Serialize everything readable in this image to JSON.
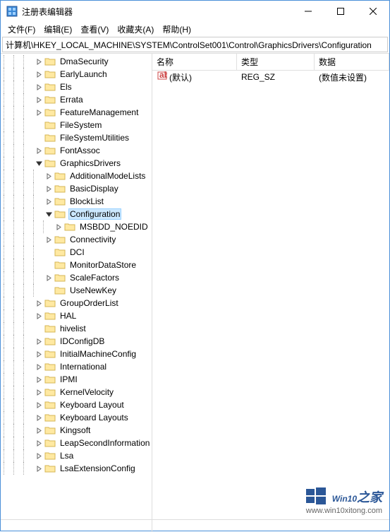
{
  "window": {
    "title": "注册表编辑器"
  },
  "menu": {
    "file": "文件(F)",
    "edit": "编辑(E)",
    "view": "查看(V)",
    "favorites": "收藏夹(A)",
    "help": "帮助(H)"
  },
  "address": "计算机\\HKEY_LOCAL_MACHINE\\SYSTEM\\ControlSet001\\Control\\GraphicsDrivers\\Configuration",
  "tree_items": [
    {
      "indent": 3,
      "toggle": ">",
      "label": "DmaSecurity",
      "selected": false
    },
    {
      "indent": 3,
      "toggle": ">",
      "label": "EarlyLaunch",
      "selected": false
    },
    {
      "indent": 3,
      "toggle": ">",
      "label": "Els",
      "selected": false
    },
    {
      "indent": 3,
      "toggle": ">",
      "label": "Errata",
      "selected": false
    },
    {
      "indent": 3,
      "toggle": ">",
      "label": "FeatureManagement",
      "selected": false
    },
    {
      "indent": 3,
      "toggle": "",
      "label": "FileSystem",
      "selected": false
    },
    {
      "indent": 3,
      "toggle": "",
      "label": "FileSystemUtilities",
      "selected": false
    },
    {
      "indent": 3,
      "toggle": ">",
      "label": "FontAssoc",
      "selected": false
    },
    {
      "indent": 3,
      "toggle": "v",
      "label": "GraphicsDrivers",
      "selected": false
    },
    {
      "indent": 4,
      "toggle": ">",
      "label": "AdditionalModeLists",
      "selected": false
    },
    {
      "indent": 4,
      "toggle": ">",
      "label": "BasicDisplay",
      "selected": false
    },
    {
      "indent": 4,
      "toggle": ">",
      "label": "BlockList",
      "selected": false
    },
    {
      "indent": 4,
      "toggle": "v",
      "label": "Configuration",
      "selected": true
    },
    {
      "indent": 5,
      "toggle": ">",
      "label": "MSBDD_NOEDID",
      "selected": false
    },
    {
      "indent": 4,
      "toggle": ">",
      "label": "Connectivity",
      "selected": false
    },
    {
      "indent": 4,
      "toggle": "",
      "label": "DCI",
      "selected": false
    },
    {
      "indent": 4,
      "toggle": "",
      "label": "MonitorDataStore",
      "selected": false
    },
    {
      "indent": 4,
      "toggle": ">",
      "label": "ScaleFactors",
      "selected": false
    },
    {
      "indent": 4,
      "toggle": "",
      "label": "UseNewKey",
      "selected": false
    },
    {
      "indent": 3,
      "toggle": ">",
      "label": "GroupOrderList",
      "selected": false
    },
    {
      "indent": 3,
      "toggle": ">",
      "label": "HAL",
      "selected": false
    },
    {
      "indent": 3,
      "toggle": "",
      "label": "hivelist",
      "selected": false
    },
    {
      "indent": 3,
      "toggle": ">",
      "label": "IDConfigDB",
      "selected": false
    },
    {
      "indent": 3,
      "toggle": ">",
      "label": "InitialMachineConfig",
      "selected": false
    },
    {
      "indent": 3,
      "toggle": ">",
      "label": "International",
      "selected": false
    },
    {
      "indent": 3,
      "toggle": ">",
      "label": "IPMI",
      "selected": false
    },
    {
      "indent": 3,
      "toggle": ">",
      "label": "KernelVelocity",
      "selected": false
    },
    {
      "indent": 3,
      "toggle": ">",
      "label": "Keyboard Layout",
      "selected": false
    },
    {
      "indent": 3,
      "toggle": ">",
      "label": "Keyboard Layouts",
      "selected": false
    },
    {
      "indent": 3,
      "toggle": ">",
      "label": "Kingsoft",
      "selected": false
    },
    {
      "indent": 3,
      "toggle": ">",
      "label": "LeapSecondInformation",
      "selected": false
    },
    {
      "indent": 3,
      "toggle": ">",
      "label": "Lsa",
      "selected": false
    },
    {
      "indent": 3,
      "toggle": ">",
      "label": "LsaExtensionConfig",
      "selected": false
    }
  ],
  "list": {
    "columns": {
      "name": "名称",
      "type": "类型",
      "data": "数据"
    },
    "rows": [
      {
        "name": "(默认)",
        "type": "REG_SZ",
        "data": "(数值未设置)"
      }
    ]
  },
  "watermark": {
    "big1": "Win10",
    "big2": "之家",
    "url": "www.win10xitong.com"
  }
}
